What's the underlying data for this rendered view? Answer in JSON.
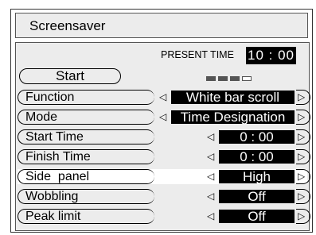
{
  "title": "Screensaver",
  "present_time": {
    "label": "PRESENT TIME",
    "value": "10 : 00"
  },
  "start_button": "Start",
  "arrows": {
    "left": "◁",
    "right": "▷"
  },
  "rows": [
    {
      "label": "Function",
      "value": "White bar scroll"
    },
    {
      "label": "Mode",
      "value": "Time Designation"
    },
    {
      "label": "Start Time",
      "value": "0 : 00"
    },
    {
      "label": "Finish Time",
      "value": "0 : 00"
    },
    {
      "label": "Side  panel",
      "value": "High"
    },
    {
      "label": "Wobbling",
      "value": "Off"
    },
    {
      "label": "Peak limit",
      "value": "Off"
    }
  ]
}
